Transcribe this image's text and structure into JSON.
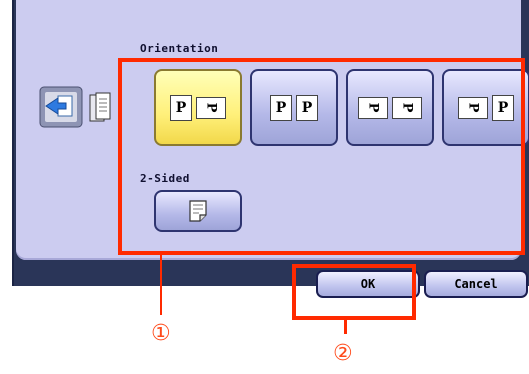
{
  "orientation": {
    "label": "Orientation",
    "options": [
      {
        "name": "orientation-option-1",
        "selected": true,
        "glyphs": [
          {
            "char": "P",
            "shape": "portrait"
          },
          {
            "char": "P",
            "shape": "landscape"
          }
        ]
      },
      {
        "name": "orientation-option-2",
        "selected": false,
        "glyphs": [
          {
            "char": "P",
            "shape": "portrait"
          },
          {
            "char": "P",
            "shape": "portrait"
          }
        ]
      },
      {
        "name": "orientation-option-3",
        "selected": false,
        "glyphs": [
          {
            "char": "P",
            "shape": "landscape"
          },
          {
            "char": "P",
            "shape": "landscape"
          }
        ]
      },
      {
        "name": "orientation-option-4",
        "selected": false,
        "glyphs": [
          {
            "char": "P",
            "shape": "landscape"
          },
          {
            "char": "P",
            "shape": "portrait"
          }
        ]
      }
    ]
  },
  "two_sided": {
    "label": "2-Sided",
    "icon": "single-page-icon"
  },
  "footer": {
    "ok_label": "OK",
    "cancel_label": "Cancel"
  },
  "callouts": {
    "one": "①",
    "two": "②"
  },
  "colors": {
    "highlight": "#ff2a00",
    "selected": "#fff07a",
    "panel": "#ccccf0",
    "frame": "#2a3558"
  }
}
